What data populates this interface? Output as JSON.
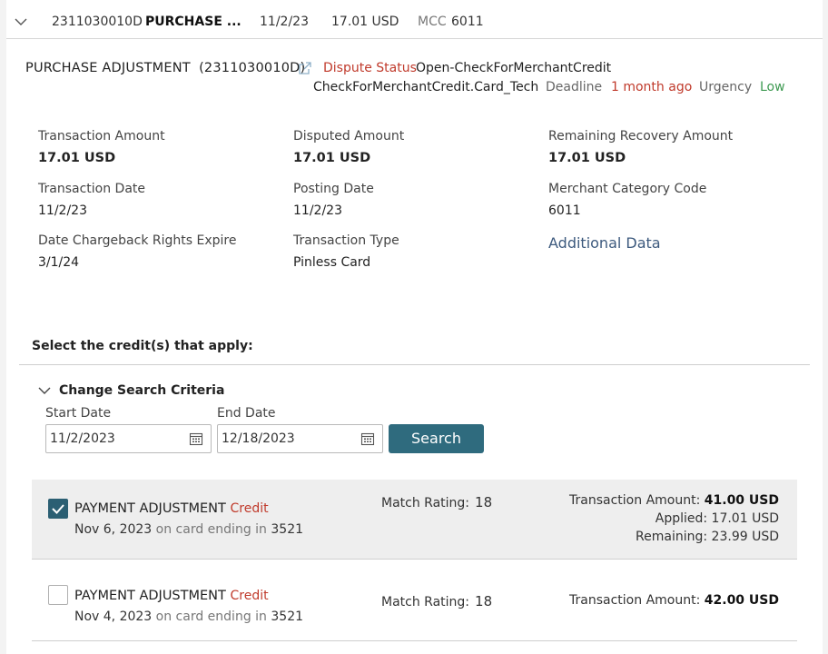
{
  "summary": {
    "id": "2311030010D",
    "type": "PURCHASE ...",
    "date": "11/2/23",
    "amount": "17.01 USD",
    "mcc_label": "MCC",
    "mcc": "6011"
  },
  "header": {
    "title": "PURCHASE ADJUSTMENT",
    "title_id": "(2311030010D)",
    "dispute_status_label": "Dispute Status",
    "dispute_status": "Open-CheckForMerchantCredit",
    "queue": "CheckForMerchantCredit.Card_Tech",
    "deadline_label": "Deadline",
    "deadline": "1 month ago",
    "urgency_label": "Urgency",
    "urgency": "Low"
  },
  "details": {
    "transaction_amount_label": "Transaction Amount",
    "transaction_amount": "17.01 USD",
    "disputed_amount_label": "Disputed Amount",
    "disputed_amount": "17.01 USD",
    "remaining_recovery_label": "Remaining Recovery Amount",
    "remaining_recovery": "17.01 USD",
    "transaction_date_label": "Transaction Date",
    "transaction_date": "11/2/23",
    "posting_date_label": "Posting Date",
    "posting_date": "11/2/23",
    "mcc_label": "Merchant Category Code",
    "mcc": "6011",
    "chargeback_expire_label": "Date Chargeback Rights Expire",
    "chargeback_expire": "3/1/24",
    "transaction_type_label": "Transaction Type",
    "transaction_type": "Pinless Card",
    "additional_data_link": "Additional Data"
  },
  "credits": {
    "section_title": "Select the credit(s) that apply:",
    "criteria_label": "Change Search Criteria",
    "start_date_label": "Start Date",
    "start_date": "11/2/2023",
    "end_date_label": "End Date",
    "end_date": "12/18/2023",
    "search_button": "Search",
    "items": [
      {
        "title": "PAYMENT ADJUSTMENT",
        "kind": "Credit",
        "date": "Nov 6, 2023",
        "card_text": "on card ending in",
        "card": "3521",
        "match_label": "Match Rating:",
        "match": "18",
        "amount_label": "Transaction Amount:",
        "amount": "41.00 USD",
        "applied": "Applied: 17.01 USD",
        "remaining": "Remaining: 23.99 USD",
        "checked": true
      },
      {
        "title": "PAYMENT ADJUSTMENT",
        "kind": "Credit",
        "date": "Nov 4, 2023",
        "card_text": "on card ending in",
        "card": "3521",
        "match_label": "Match Rating:",
        "match": "18",
        "amount_label": "Transaction Amount:",
        "amount": "42.00 USD",
        "checked": false
      }
    ]
  },
  "colors": {
    "accent": "#2f6b7e",
    "status_red": "#c03a2b",
    "urgency_green": "#3e9a52",
    "link": "#3d5a7e"
  },
  "icons": [
    "chevron-down-icon",
    "external-link-icon",
    "calendar-icon",
    "checkmark-icon"
  ]
}
